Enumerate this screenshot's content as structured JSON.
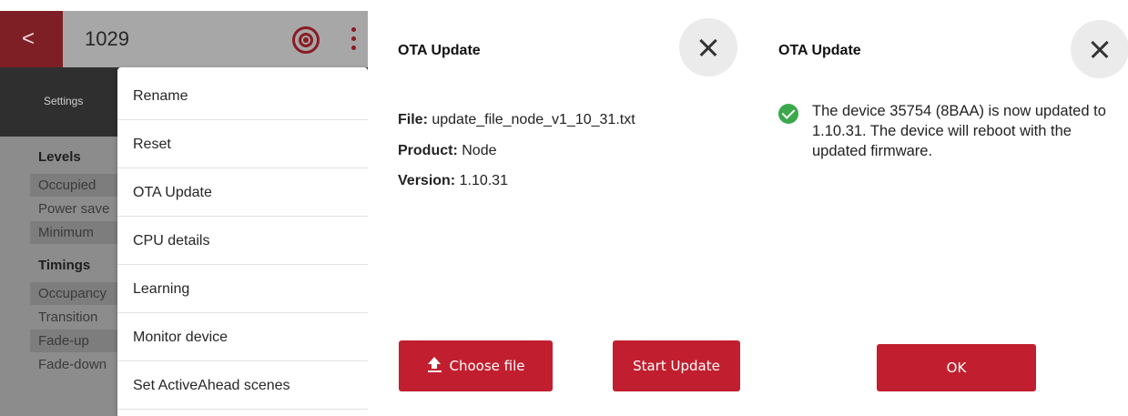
{
  "device_screen": {
    "title": "1029",
    "back_icon": "<",
    "tab_label": "Settings",
    "sections": [
      {
        "title": "Levels",
        "rows": [
          "Occupied",
          "Power save",
          "Minimum"
        ]
      },
      {
        "title": "Timings",
        "rows": [
          "Occupancy",
          "Transition",
          "Fade-up",
          "Fade-down"
        ]
      }
    ],
    "menu_items": [
      "Rename",
      "Reset",
      "OTA Update",
      "CPU details",
      "Learning",
      "Monitor device",
      "Set ActiveAhead scenes"
    ],
    "icons": {
      "back": "chevron-left-icon",
      "identify": "target-icon",
      "more": "more-vertical-icon"
    },
    "colors": {
      "accent": "#8a1b23",
      "tab_bar": "#2f2f2f"
    }
  },
  "ota_form": {
    "title": "OTA Update",
    "file_label": "File:",
    "file_value": "update_file_node_v1_10_31.txt",
    "product_label": "Product:",
    "product_value": "Node",
    "version_label": "Version:",
    "version_value": "1.10.31",
    "choose_file_label": "Choose file",
    "start_update_label": "Start Update",
    "icons": {
      "close": "close-icon",
      "upload": "upload-icon"
    },
    "colors": {
      "button": "#c11f2f"
    }
  },
  "ota_result": {
    "title": "OTA Update",
    "message": "The device 35754 (8BAA) is now updated to 1.10.31. The device will reboot with the updated firmware.",
    "ok_label": "OK",
    "icons": {
      "close": "close-icon",
      "status": "check-circle-icon"
    },
    "colors": {
      "success": "#3aa84b"
    }
  }
}
